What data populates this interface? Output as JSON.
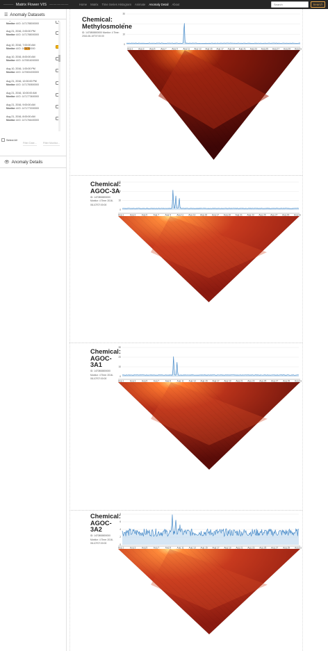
{
  "navbar": {
    "brand_left_dashes": "———",
    "brand_title": "Matrix Flower VIS",
    "brand_right_dashes": "— — — — —",
    "links": [
      "Home",
      "Matrix",
      "Time Series Histogram",
      "Animate",
      "Anomaly Detail",
      "About"
    ],
    "active_index": 4,
    "search_placeholder": "Search",
    "search_button": "Search",
    "accent": "#f0ad4e"
  },
  "sidebar": {
    "datasets_title": "Anomaly Datasets",
    "datasets_icon": "list-icon",
    "items": [
      {
        "date": "Aug 21, 2016, 2:00:00 PM",
        "monitor_label": "Monitor: 4",
        "id": "ID: 1471788000000",
        "checked": false,
        "partial": true
      },
      {
        "date": "Aug 21, 2016, 2:00:00 PM",
        "monitor_label": "Monitor: 4",
        "id": "ID: 1471788000000",
        "checked": false
      },
      {
        "date": "Aug 10, 2016, 7:00:00 AM",
        "monitor_label": "Monitor: 4",
        "id_prefix": "ID: 14",
        "id_highlight": "7079",
        "id_suffix": "0000",
        "checked": true
      },
      {
        "date": "Aug 10, 2016, 8:00:00 AM",
        "monitor_label": "Monitor: 4",
        "id": "ID: 1470816000000",
        "checked": false
      },
      {
        "date": "Aug 10, 2016, 1:00:00 PM",
        "monitor_label": "Monitor: 4",
        "id": "ID: 1470834000000",
        "checked": false
      },
      {
        "date": "Aug 21, 2016, 12:00:00 PM",
        "monitor_label": "Monitor: 4",
        "id": "ID: 1471780800000",
        "checked": false
      },
      {
        "date": "Aug 21, 2016, 10:00:00 AM",
        "monitor_label": "Monitor: 4",
        "id": "ID: 1471773600000",
        "checked": false
      },
      {
        "date": "Aug 21, 2016, 9:00:00 AM",
        "monitor_label": "Monitor: 4",
        "id": "ID: 1471770000000",
        "checked": false
      },
      {
        "date": "Aug 21, 2016, 8:00:00 AM",
        "monitor_label": "Monitor: 4",
        "id": "ID: 1471766400000",
        "checked": false
      }
    ],
    "select_all": "Select All",
    "filter_date": "Filter Date...",
    "filter_monitor": "Filter Monitor...",
    "details_title": "Anomaly Details",
    "details_icon": "eye-icon"
  },
  "x_ticks": [
    "Aug 1",
    "Aug 3",
    "Aug 5",
    "Aug 7",
    "Aug 9",
    "Aug 11",
    "Aug 13",
    "Aug 15",
    "Aug 17",
    "Aug 19",
    "Aug 21",
    "Aug 23",
    "Aug 25",
    "Aug 27",
    "Aug 29",
    "Aug 31"
  ],
  "panels": [
    {
      "title": "Chemical: Methylosmolene",
      "title_lines": [
        "Chemical:",
        "Methylosmolene"
      ],
      "meta": [
        "ID: 1470808800000 Monitor: 4 Time:",
        "2016-08-10T07:00:00"
      ],
      "ylim": [
        0,
        30
      ],
      "yticks": [
        "30",
        "20",
        "10",
        "0"
      ],
      "peaks": [
        {
          "day": 10.3,
          "value": 23
        }
      ],
      "baseline": 1.2,
      "noise": 0.2,
      "heatmap_tone": "dark"
    },
    {
      "title": "Chemical: AGOC-3A",
      "title_lines": [
        "Chemical:",
        "AGOC-3A"
      ],
      "meta": [
        "ID: 1470808800000",
        "Monitor: 4 Time: 2016-",
        "08-10T07:00:00"
      ],
      "ylim": [
        0,
        30
      ],
      "yticks": [
        "30",
        "20",
        "10",
        "0"
      ],
      "peaks": [
        {
          "day": 8.9,
          "value": 22
        },
        {
          "day": 9.4,
          "value": 15
        },
        {
          "day": 10.0,
          "value": 13
        }
      ],
      "baseline": 1.5,
      "noise": 0.25,
      "heatmap_tone": "bright"
    },
    {
      "title": "Chemical: AGOC-3A1",
      "title_lines": [
        "Chemical:",
        "AGOC-",
        "3A1"
      ],
      "meta": [
        "ID: 1470808800000",
        "Monitor: 4 Time: 2016-",
        "08-10T07:00:00"
      ],
      "ylim": [
        0,
        30
      ],
      "yticks": [
        "30",
        "20",
        "10",
        "0"
      ],
      "peaks": [
        {
          "day": 9.0,
          "value": 21
        },
        {
          "day": 9.6,
          "value": 15
        }
      ],
      "baseline": 1.5,
      "noise": 0.25,
      "heatmap_tone": "mixed"
    },
    {
      "title": "Chemical: AGOC-3A2",
      "title_lines": [
        "Chemical:",
        "AGOC-",
        "3A2"
      ],
      "meta": [
        "ID: 1470808800000",
        "Monitor: 4 Time: 2016-",
        "08-10T07:00:00"
      ],
      "ylim": [
        0,
        8
      ],
      "yticks": [
        "8",
        "6",
        "4",
        "2",
        "0"
      ],
      "peaks": [
        {
          "day": 8.8,
          "value": 7.2
        },
        {
          "day": 9.4,
          "value": 6.8
        },
        {
          "day": 10.1,
          "value": 5.8
        }
      ],
      "baseline": 3.2,
      "noise": 1.0,
      "heatmap_tone": "bright"
    }
  ],
  "colors": {
    "line": "#4a8cc9",
    "fill": "#c4dbef",
    "grid": "#e8e8e8",
    "heat_dark": "#3d0606",
    "heat_mid": "#a52b14",
    "heat_bright": "#ff8a3a"
  }
}
